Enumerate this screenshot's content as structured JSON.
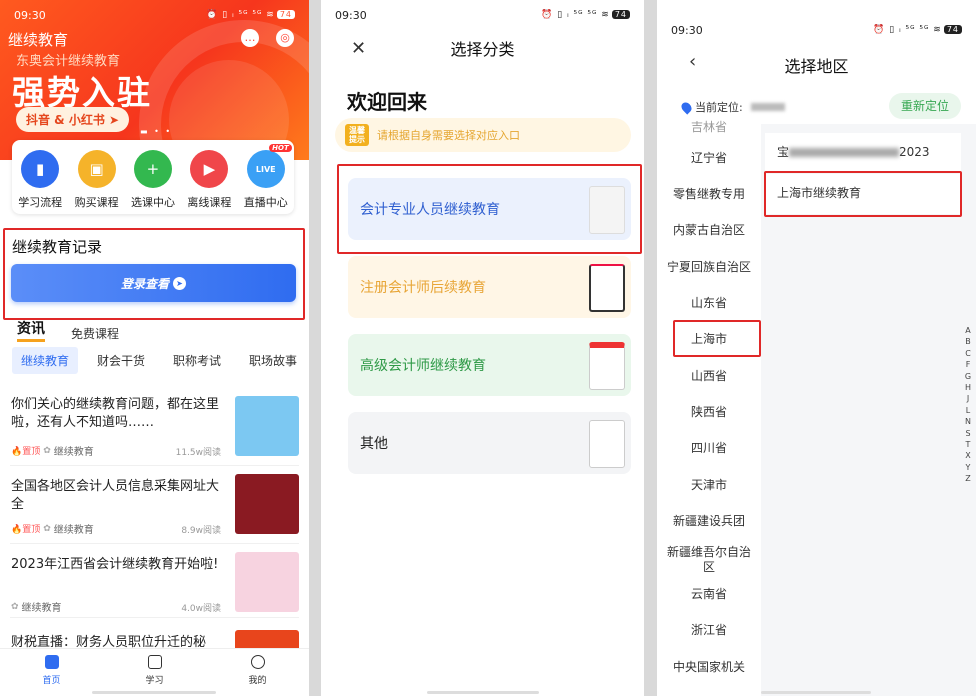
{
  "status": {
    "time": "09:30",
    "icons": "⏰ ▯ ᵢ ⁵ᴳ ⁵ᴳ ≋",
    "battery": "74"
  },
  "screen1": {
    "header_title": "继续教育",
    "hero_subtitle": "东奥会计继续教育",
    "hero_headline": "强势入驻",
    "hero_button": "抖音 & 小红书 ➤",
    "hero_dots": "▬ • •",
    "quick_actions": [
      {
        "label": "学习流程",
        "icon": "flow-icon",
        "color": "#2f6cf0",
        "glyph": "▮"
      },
      {
        "label": "购买课程",
        "icon": "bag-icon",
        "color": "#f5b32a",
        "glyph": "▣"
      },
      {
        "label": "选课中心",
        "icon": "plus-icon",
        "color": "#33b84f",
        "glyph": "+"
      },
      {
        "label": "离线课程",
        "icon": "play-icon",
        "color": "#f0464a",
        "glyph": "▶"
      },
      {
        "label": "直播中心",
        "icon": "live-icon",
        "color": "#3aa0f5",
        "glyph": "LIVE",
        "badge": "HOT"
      }
    ],
    "record_title": "继续教育记录",
    "login_button": "登录查看",
    "tabs": [
      "资讯",
      "免费课程"
    ],
    "chips": [
      "继续教育",
      "财会干货",
      "职称考试",
      "职场故事"
    ],
    "articles": [
      {
        "title": "你们关心的继续教育问题，都在这里啦，还有人不知道吗……",
        "top": "🔥置顶",
        "category": "继续教育",
        "reads": "11.5w阅读",
        "thumb_color": "#7cc8f2"
      },
      {
        "title": "全国各地区会计人员信息采集网址大全",
        "top": "🔥置顶",
        "category": "继续教育",
        "reads": "8.9w阅读",
        "thumb_color": "#8a1a22"
      },
      {
        "title": "2023年江西省会计继续教育开始啦!",
        "top": "",
        "category": "继续教育",
        "reads": "4.0w阅读",
        "thumb_color": "#f7d3e0"
      },
      {
        "title": "财税直播：财务人员职位升迁的秘",
        "top": "",
        "category": "",
        "reads": "",
        "thumb_color": "#e8451c"
      }
    ],
    "nav": [
      {
        "label": "首页",
        "active": true
      },
      {
        "label": "学习",
        "active": false
      },
      {
        "label": "我的",
        "active": false
      }
    ]
  },
  "screen2": {
    "title": "选择分类",
    "close_glyph": "✕",
    "welcome": "欢迎回来",
    "tip_badge": "温馨提示",
    "tip_text": "请根据自身需要选择对应入口",
    "cards": [
      {
        "label": "会计专业人员继续教育",
        "bg": "#ebf1fd",
        "color": "#2f5fd0"
      },
      {
        "label": "注册会计师后续教育",
        "bg": "#fff6e6",
        "color": "#e8a638"
      },
      {
        "label": "高级会计师继续教育",
        "bg": "#e9f7ec",
        "color": "#2f9a47"
      },
      {
        "label": "其他",
        "bg": "#f3f4f6",
        "color": "#222"
      }
    ]
  },
  "screen3": {
    "title": "选择地区",
    "back_glyph": "‹",
    "location_label": "当前定位:",
    "relocate": "重新定位",
    "provinces": [
      "吉林省",
      "辽宁省",
      "零售继教专用",
      "内蒙古自治区",
      "宁夏回族自治区",
      "山东省",
      "上海市",
      "山西省",
      "陕西省",
      "四川省",
      "天津市",
      "新疆建设兵团",
      "新疆维吾尔自治区",
      "云南省",
      "浙江省",
      "中央国家机关"
    ],
    "cities": [
      "宝",
      "上海市继续教育"
    ],
    "city_suffix": "2023",
    "alphabet": [
      "A",
      "B",
      "C",
      "F",
      "G",
      "H",
      "J",
      "L",
      "N",
      "S",
      "T",
      "X",
      "Y",
      "Z"
    ]
  }
}
